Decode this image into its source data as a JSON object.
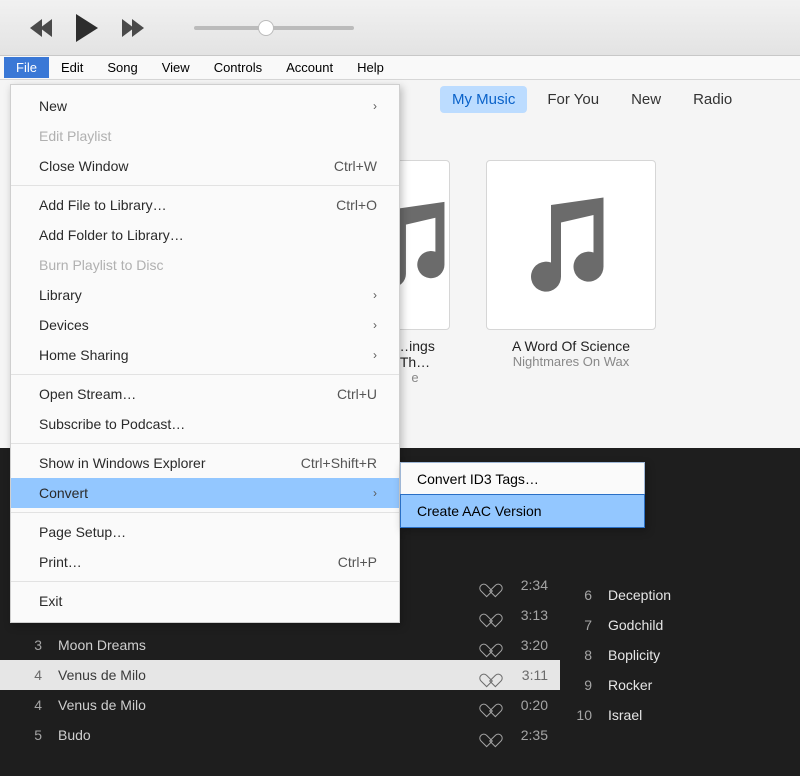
{
  "menuBar": {
    "items": [
      "File",
      "Edit",
      "Song",
      "View",
      "Controls",
      "Account",
      "Help"
    ],
    "activeIndex": 0
  },
  "navTabs": {
    "items": [
      "My Music",
      "For You",
      "New",
      "Radio"
    ],
    "activeIndex": 0
  },
  "albums": [
    {
      "title": "…ings Th…",
      "artist": "e"
    },
    {
      "title": "A Word Of Science",
      "artist": "Nightmares On Wax"
    }
  ],
  "fileMenu": {
    "items": [
      {
        "label": "New",
        "submenu": true
      },
      {
        "label": "Edit Playlist",
        "disabled": true
      },
      {
        "label": "Close Window",
        "shortcut": "Ctrl+W"
      },
      {
        "sep": true
      },
      {
        "label": "Add File to Library…",
        "shortcut": "Ctrl+O"
      },
      {
        "label": "Add Folder to Library…"
      },
      {
        "label": "Burn Playlist to Disc",
        "disabled": true
      },
      {
        "label": "Library",
        "submenu": true
      },
      {
        "label": "Devices",
        "submenu": true
      },
      {
        "label": "Home Sharing",
        "submenu": true
      },
      {
        "sep": true
      },
      {
        "label": "Open Stream…",
        "shortcut": "Ctrl+U"
      },
      {
        "label": "Subscribe to Podcast…"
      },
      {
        "sep": true
      },
      {
        "label": "Show in Windows Explorer",
        "shortcut": "Ctrl+Shift+R"
      },
      {
        "label": "Convert",
        "submenu": true,
        "hover": true
      },
      {
        "sep": true
      },
      {
        "label": "Page Setup…"
      },
      {
        "label": "Print…",
        "shortcut": "Ctrl+P"
      },
      {
        "sep": true
      },
      {
        "label": "Exit"
      }
    ]
  },
  "subMenu": {
    "items": [
      {
        "label": "Convert ID3 Tags…"
      },
      {
        "label": "Create AAC Version",
        "hover": true
      }
    ]
  },
  "tracksLeft": [
    {
      "idx": "",
      "title": "",
      "dur": "2:34"
    },
    {
      "idx": "",
      "title": "",
      "dur": "3:13"
    },
    {
      "idx": "3",
      "title": "Moon Dreams",
      "dur": "3:20"
    },
    {
      "idx": "4",
      "title": "Venus de Milo",
      "dur": "3:11",
      "selected": true
    },
    {
      "idx": "4",
      "title": "Venus de Milo",
      "dur": "0:20"
    },
    {
      "idx": "5",
      "title": "Budo",
      "dur": "2:35"
    }
  ],
  "tracksRight": [
    {
      "idx": "6",
      "title": "Deception"
    },
    {
      "idx": "7",
      "title": "Godchild"
    },
    {
      "idx": "8",
      "title": "Boplicity"
    },
    {
      "idx": "9",
      "title": "Rocker"
    },
    {
      "idx": "10",
      "title": "Israel"
    }
  ],
  "icons": {
    "apple": "",
    "chevron": "›",
    "heart": "♡"
  }
}
